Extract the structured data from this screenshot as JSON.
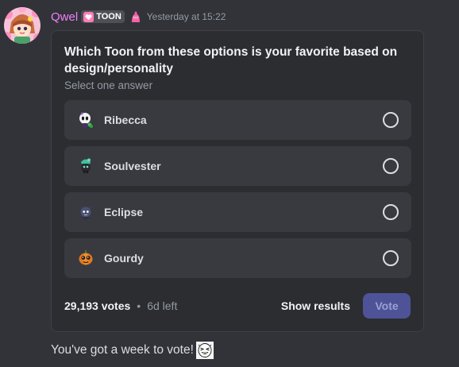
{
  "message": {
    "author": "Qwel",
    "tag": {
      "icon": "pink-heart-icon",
      "label": "TOON"
    },
    "role_icon": "pink-toon-role-icon",
    "timestamp": "Yesterday at 15:22",
    "colors": {
      "username": "#f47fff",
      "tag_icon": "#ff7eb9"
    }
  },
  "poll": {
    "question": "Which Toon from these options is your favorite based on design/personality",
    "subtitle": "Select one answer",
    "answers": [
      {
        "label": "Ribecca",
        "emoji": "ribecca-emoji"
      },
      {
        "label": "Soulvester",
        "emoji": "soulvester-emoji"
      },
      {
        "label": "Eclipse",
        "emoji": "eclipse-emoji"
      },
      {
        "label": "Gourdy",
        "emoji": "gourdy-emoji"
      }
    ],
    "votes": "29,193 votes",
    "separator": "•",
    "time_left": "6d left",
    "show_results": "Show results",
    "vote_button": "Vote",
    "colors": {
      "vote_button_bg": "#4e5398",
      "card_bg": "#2b2d31",
      "answer_bg": "#383a40"
    }
  },
  "followup": {
    "text": "You've got a week to vote!",
    "emoji": "laughing-face-emoji"
  }
}
